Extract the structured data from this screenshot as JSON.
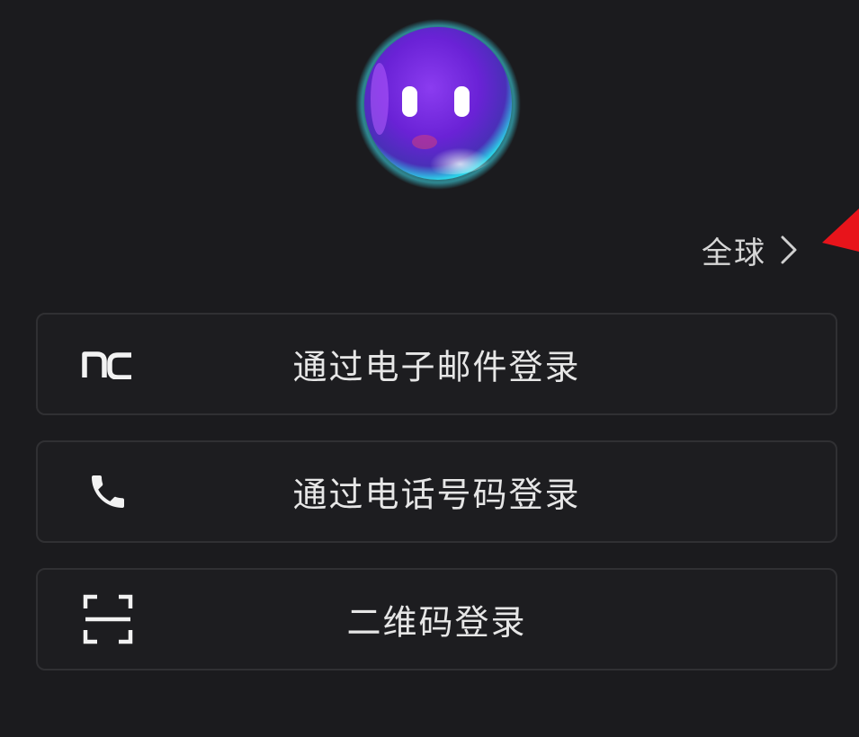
{
  "region": {
    "label": "全球",
    "chevron_icon": "chevron-right-icon"
  },
  "mascot": {
    "icon": "bubble-mascot-logo"
  },
  "annotation": {
    "icon": "red-pointer-arrow",
    "color": "#e8141b"
  },
  "login_options": [
    {
      "label": "通过电子邮件登录",
      "icon": "nc-logo-icon"
    },
    {
      "label": "通过电话号码登录",
      "icon": "phone-icon"
    },
    {
      "label": "二维码登录",
      "icon": "qr-scan-icon"
    }
  ],
  "colors": {
    "background": "#1b1b1e",
    "button_border": "#303033",
    "text": "#e6e6e6"
  }
}
